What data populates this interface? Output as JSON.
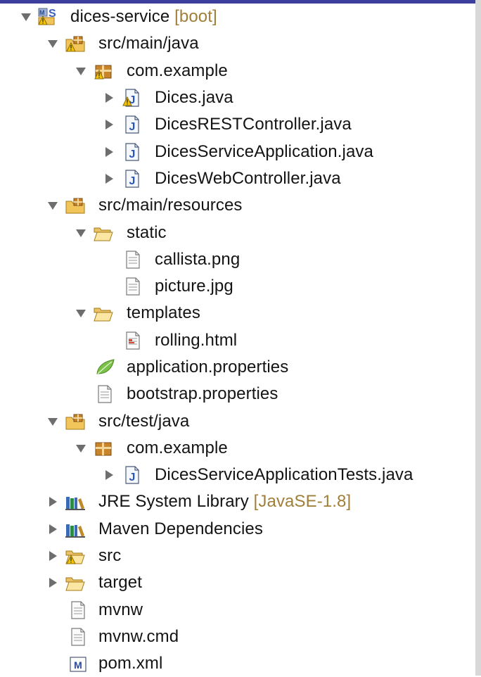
{
  "tree": [
    {
      "label": "dices-service",
      "decoration": "[boot]",
      "twisty": "expanded",
      "icon": "boot-project-icon"
    },
    {
      "label": "src/main/java",
      "twisty": "expanded",
      "icon": "source-folder-warning-icon"
    },
    {
      "label": "com.example",
      "twisty": "expanded",
      "icon": "package-warning-icon"
    },
    {
      "label": "Dices.java",
      "twisty": "collapsed",
      "icon": "java-file-warning-icon"
    },
    {
      "label": "DicesRESTController.java",
      "twisty": "collapsed",
      "icon": "java-file-icon"
    },
    {
      "label": "DicesServiceApplication.java",
      "twisty": "collapsed",
      "icon": "java-file-icon"
    },
    {
      "label": "DicesWebController.java",
      "twisty": "collapsed",
      "icon": "java-file-icon"
    },
    {
      "label": "src/main/resources",
      "twisty": "expanded",
      "icon": "source-folder-icon"
    },
    {
      "label": "static",
      "twisty": "expanded",
      "icon": "folder-open-icon"
    },
    {
      "label": "callista.png",
      "twisty": "none",
      "icon": "file-icon"
    },
    {
      "label": "picture.jpg",
      "twisty": "none",
      "icon": "file-icon"
    },
    {
      "label": "templates",
      "twisty": "expanded",
      "icon": "folder-open-icon"
    },
    {
      "label": "rolling.html",
      "twisty": "none",
      "icon": "html-file-icon"
    },
    {
      "label": "application.properties",
      "twisty": "none",
      "icon": "spring-leaf-icon"
    },
    {
      "label": "bootstrap.properties",
      "twisty": "none",
      "icon": "file-icon"
    },
    {
      "label": "src/test/java",
      "twisty": "expanded",
      "icon": "source-folder-icon"
    },
    {
      "label": "com.example",
      "twisty": "expanded",
      "icon": "package-icon"
    },
    {
      "label": "DicesServiceApplicationTests.java",
      "twisty": "collapsed",
      "icon": "java-file-icon"
    },
    {
      "label": "JRE System Library",
      "decoration": "[JavaSE-1.8]",
      "twisty": "collapsed",
      "icon": "library-icon"
    },
    {
      "label": "Maven Dependencies",
      "twisty": "collapsed",
      "icon": "library-icon"
    },
    {
      "label": "src",
      "twisty": "collapsed",
      "icon": "folder-warning-icon"
    },
    {
      "label": "target",
      "twisty": "collapsed",
      "icon": "folder-open-icon"
    },
    {
      "label": "mvnw",
      "twisty": "none",
      "icon": "file-icon"
    },
    {
      "label": "mvnw.cmd",
      "twisty": "none",
      "icon": "file-icon"
    },
    {
      "label": "pom.xml",
      "twisty": "none",
      "icon": "maven-pom-icon"
    }
  ]
}
